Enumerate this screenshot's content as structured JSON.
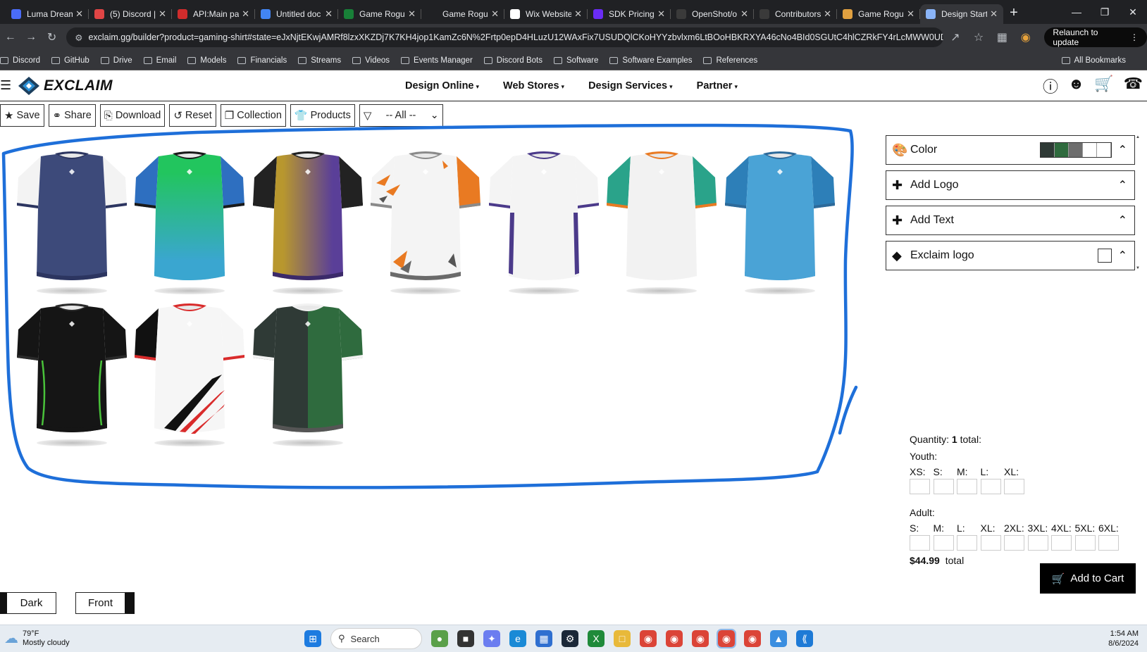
{
  "browser": {
    "tabs": [
      {
        "title": "Luma Dream",
        "color": "#4a6cf7"
      },
      {
        "title": "(5) Discord |",
        "color": "#e04545"
      },
      {
        "title": "API:Main pa",
        "color": "#d02c2c"
      },
      {
        "title": "Untitled doc",
        "color": "#4285f4"
      },
      {
        "title": "Game Rogue",
        "color": "#188038"
      },
      {
        "title": "Game Rogue",
        "color": "#202124"
      },
      {
        "title": "Wix Website",
        "color": "#ffffff"
      },
      {
        "title": "SDK Pricing",
        "color": "#6a2cf5"
      },
      {
        "title": "OpenShot/o",
        "color": "#3a3a3a"
      },
      {
        "title": "Contributors",
        "color": "#3a3a3a"
      },
      {
        "title": "Game Rogue",
        "color": "#e0a040"
      },
      {
        "title": "Design Start",
        "color": "#8ab4f8",
        "active": true
      }
    ],
    "new_tab": "+",
    "url": "exclaim.gg/builder?product=gaming-shirt#state=eJxNjtEKwjAMRf8lzxXKZDj7K7KH4jop1KamZc6N%2Frtp0epD4HLuzU12WAxFix7USUDQlCKoHYYzbvlxm6LtBOoHBKRXYA46cNo4BId0SGUtC4hlCZRkFY4rLcMWW0UD31QnW1I4HhzekK...",
    "relaunch_label": "Relaunch to update",
    "bookmarks": [
      "Discord",
      "GitHub",
      "Drive",
      "Email",
      "Models",
      "Financials",
      "Streams",
      "Videos",
      "Events Manager",
      "Discord Bots",
      "Software",
      "Software Examples",
      "References"
    ],
    "all_bookmarks": "All Bookmarks"
  },
  "site": {
    "logo_text": "EXCLAIM",
    "nav": [
      "Design Online",
      "Web Stores",
      "Design Services",
      "Partner"
    ]
  },
  "toolbar": {
    "save": "Save",
    "share": "Share",
    "download": "Download",
    "reset": "Reset",
    "collection": "Collection",
    "products": "Products",
    "filter_value": "-- All --"
  },
  "designs": [
    {
      "name": "navy-white-sleeves",
      "body": "#3d4a7a",
      "sleeve": "#f3f3f3",
      "collar": "#2c3560",
      "bottom": "#2c3560"
    },
    {
      "name": "green-blue-gradient",
      "body": "#22c55e",
      "body2": "#3aa6d0",
      "sleeve": "#2e6fc0",
      "collar": "#1a1a1a",
      "bottom": "#3aa6d0"
    },
    {
      "name": "gold-purple-gradient",
      "body": "#b8972e",
      "body2": "#5a3f98",
      "sleeve": "#222222",
      "collar": "#222222",
      "bottom": "#3b2a6a"
    },
    {
      "name": "white-orange-shards",
      "body": "#f4f4f4",
      "sleeve": "#f4f4f4",
      "sleeve_r": "#e97a22",
      "collar": "#8a8a8a",
      "bottom": "#6a6a6a",
      "accent": "#e97a22"
    },
    {
      "name": "white-purple-sides",
      "body": "#f4f4f4",
      "sleeve": "#f4f4f4",
      "collar": "#4b3a8a",
      "bottom": "#f4f4f4",
      "accent": "#4b3a8a"
    },
    {
      "name": "white-teal-sleeves",
      "body": "#f2f2f2",
      "sleeve": "#2aa38a",
      "collar": "#e97a22",
      "bottom": "#f2f2f2"
    },
    {
      "name": "sky-blue",
      "body": "#4aa3d6",
      "sleeve": "#2d7fb8",
      "collar": "#2d6a9a",
      "bottom": "#4aa3d6"
    },
    {
      "name": "black-green-piping",
      "body": "#151515",
      "sleeve": "#151515",
      "collar": "#2a2a2a",
      "bottom": "#151515",
      "accent": "#49c23a"
    },
    {
      "name": "white-black-red-stripes",
      "body": "#f6f6f6",
      "sleeve": "#111111",
      "sleeve_r": "#f6f6f6",
      "collar": "#d92b2b",
      "bottom": "#f6f6f6",
      "accent": "#d92b2b"
    },
    {
      "name": "charcoal-green-split",
      "body": "#2f3a36",
      "body2": "#2f6b3e",
      "sleeve": "#2f3a36",
      "sleeve_r": "#2f6b3e",
      "collar": "#f2f2f2",
      "bottom": "#555555"
    }
  ],
  "panel": {
    "color_label": "Color",
    "swatches": [
      "#2f3a36",
      "#2f6b3e",
      "#6e6e6e",
      "#ffffff",
      "#ffffff"
    ],
    "add_logo": "Add Logo",
    "add_text": "Add Text",
    "exclaim_logo": "Exclaim logo"
  },
  "quantity": {
    "label": "Quantity:",
    "count": "1",
    "total_word": "total:",
    "youth_label": "Youth:",
    "youth_sizes": [
      "XS:",
      "S:",
      "M:",
      "L:",
      "XL:"
    ],
    "adult_label": "Adult:",
    "adult_sizes": [
      "S:",
      "M:",
      "L:",
      "XL:",
      "2XL:",
      "3XL:",
      "4XL:",
      "5XL:",
      "6XL:"
    ],
    "price": "$44.99",
    "price_suffix": "total",
    "add_to_cart": "Add to Cart"
  },
  "bottom": {
    "dark": "Dark",
    "front": "Front"
  },
  "taskbar": {
    "temp": "79°F",
    "condition": "Mostly cloudy",
    "search": "Search",
    "time": "1:54 AM",
    "date": "8/6/2024"
  },
  "highlight_color": "#1e6fd9"
}
